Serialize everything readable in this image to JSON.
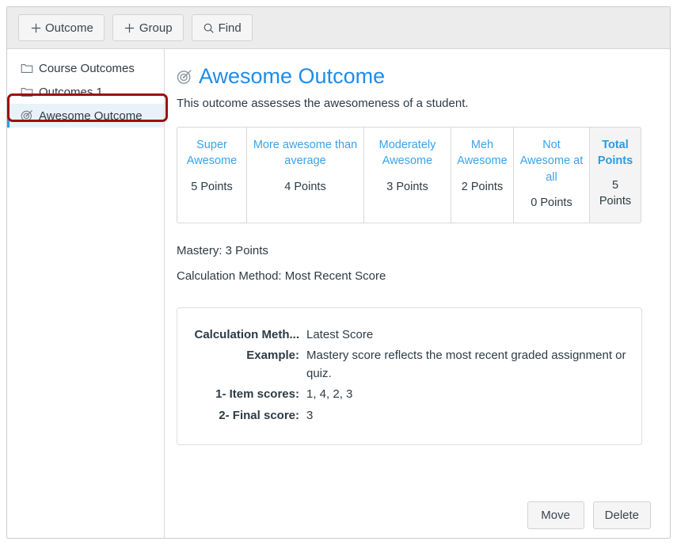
{
  "toolbar": {
    "buttons": [
      {
        "icon": "plus-icon",
        "label": "Outcome"
      },
      {
        "icon": "plus-icon",
        "label": "Group"
      },
      {
        "icon": "search-icon",
        "label": "Find"
      }
    ]
  },
  "sidebar": {
    "items": [
      {
        "icon": "folder-icon",
        "label": "Course Outcomes",
        "selected": false
      },
      {
        "icon": "folder-icon",
        "label": "Outcomes 1",
        "selected": false
      },
      {
        "icon": "target-icon",
        "label": "Awesome Outcome",
        "selected": true
      }
    ]
  },
  "main": {
    "title_icon": "target-icon",
    "title": "Awesome Outcome",
    "description": "This outcome assesses the awesomeness of a student.",
    "ratings": [
      {
        "name": "Super Awesome",
        "points": "5 Points",
        "total": false
      },
      {
        "name": "More awesome than average",
        "points": "4 Points",
        "total": false
      },
      {
        "name": "Moderately Awesome",
        "points": "3 Points",
        "total": false
      },
      {
        "name": "Meh Awesome",
        "points": "2 Points",
        "total": false
      },
      {
        "name": "Not Awesome at all",
        "points": "0 Points",
        "total": false
      },
      {
        "name": "Total Points",
        "points": "5 Points",
        "total": true
      }
    ],
    "mastery": "Mastery: 3 Points",
    "calculation_method": "Calculation Method: Most Recent Score",
    "detail_rows": [
      {
        "label": "Calculation Meth...",
        "value": "Latest Score"
      },
      {
        "label": "Example:",
        "value": "Mastery score reflects the most recent graded assignment or quiz."
      },
      {
        "label": "1- Item scores:",
        "value": "1, 4, 2, 3"
      },
      {
        "label": "2- Final score:",
        "value": "3"
      }
    ],
    "footer_buttons": [
      {
        "label": "Move"
      },
      {
        "label": "Delete"
      }
    ]
  },
  "colors": {
    "accent_blue": "#1f8ce8",
    "rating_blue": "#3aa3ea",
    "annotation_red": "#a00b0b",
    "toolbar_bg": "#ececec",
    "selected_bg": "#e8f2f9",
    "selected_bar": "#2e9de0",
    "text": "#2d3b45"
  }
}
